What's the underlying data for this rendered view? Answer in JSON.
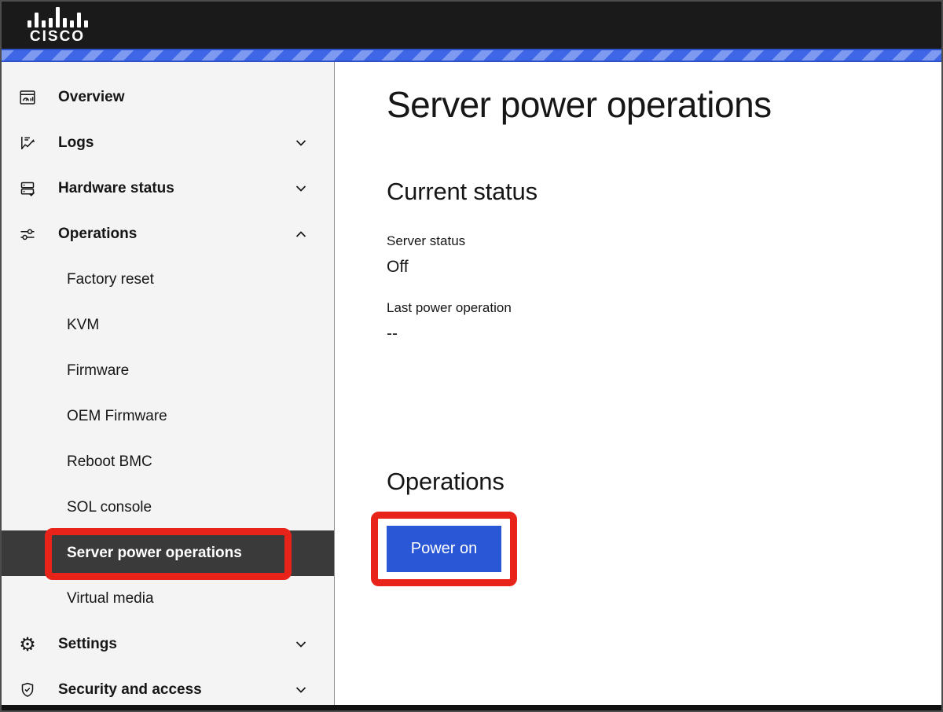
{
  "colors": {
    "header-bg": "#1a1a1a",
    "stripe-dark": "#3f66e6",
    "stripe-light": "#7e9af0",
    "stripe-edge": "#2d51c8",
    "sidebar-bg": "#f4f4f4",
    "active-item-bg": "#3a3a3a",
    "accent-blue": "#2a57d5",
    "annotation-red": "#e8241a",
    "text-primary": "#161616",
    "divider": "#8f8f8f"
  },
  "header": {
    "brand": "CISCO"
  },
  "sidebar": {
    "items": [
      {
        "label": "Overview",
        "icon": "overview-icon",
        "level": "top",
        "chevron": "none",
        "active": false
      },
      {
        "label": "Logs",
        "icon": "logs-icon",
        "level": "top",
        "chevron": "down",
        "active": false
      },
      {
        "label": "Hardware status",
        "icon": "hardware-status-icon",
        "level": "top",
        "chevron": "down",
        "active": false
      },
      {
        "label": "Operations",
        "icon": "operations-icon",
        "level": "top",
        "chevron": "up",
        "active": false,
        "expanded": true
      },
      {
        "label": "Factory reset",
        "level": "sub",
        "active": false
      },
      {
        "label": "KVM",
        "level": "sub",
        "active": false
      },
      {
        "label": "Firmware",
        "level": "sub",
        "active": false
      },
      {
        "label": "OEM Firmware",
        "level": "sub",
        "active": false
      },
      {
        "label": "Reboot BMC",
        "level": "sub",
        "active": false
      },
      {
        "label": "SOL console",
        "level": "sub",
        "active": false
      },
      {
        "label": "Server power operations",
        "level": "sub",
        "active": true,
        "highlighted": true
      },
      {
        "label": "Virtual media",
        "level": "sub",
        "active": false
      },
      {
        "label": "Settings",
        "icon": "settings-icon",
        "level": "top",
        "chevron": "down",
        "active": false
      },
      {
        "label": "Security and access",
        "icon": "security-icon",
        "level": "top",
        "chevron": "down",
        "active": false
      }
    ]
  },
  "main": {
    "title": "Server power operations",
    "current_status": {
      "heading": "Current status",
      "fields": [
        {
          "label": "Server status",
          "value": "Off"
        },
        {
          "label": "Last power operation",
          "value": "--"
        }
      ]
    },
    "operations": {
      "heading": "Operations",
      "power_on_label": "Power on",
      "power_on_highlighted": true
    }
  }
}
